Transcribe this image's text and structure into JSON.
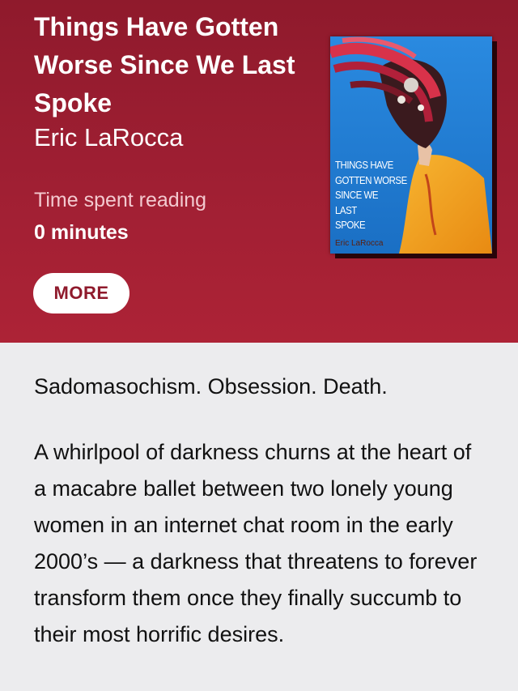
{
  "book": {
    "title": "Things Have Gotten Worse Since We Last Spoke",
    "author": "Eric LaRocca",
    "time_label": "Time spent reading",
    "time_value": "0 minutes",
    "more_label": "MORE"
  },
  "cover": {
    "lines": [
      "THINGS HAVE",
      "GOTTEN WORSE",
      "SINCE WE",
      "LAST",
      "SPOKE"
    ],
    "author": "Eric LaRocca",
    "colors": {
      "background": "#1f7fd6",
      "sweater": "#f0a21c",
      "hair": "#d8324a"
    }
  },
  "description": {
    "tagline": "Sadomasochism. Obsession. Death.",
    "body": "A whirlpool of darkness churns at the heart of a macabre ballet between two lonely young women in an internet chat room in the early 2000’s — a darkness that threatens to forever transform them once they finally succumb to their most horrific desires."
  },
  "colors": {
    "header": "#a01f33",
    "background": "#ececee",
    "accent": "#8f1a2c"
  }
}
